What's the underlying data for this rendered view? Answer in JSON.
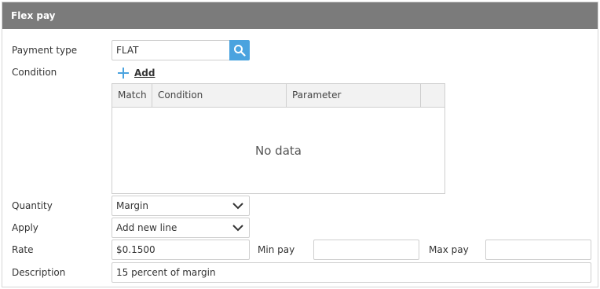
{
  "panel": {
    "title": "Flex pay"
  },
  "payment_type": {
    "label": "Payment type",
    "value": "FLAT"
  },
  "condition": {
    "label": "Condition",
    "add_label": "Add",
    "columns": [
      "Match",
      "Condition",
      "Parameter"
    ],
    "empty_text": "No data"
  },
  "quantity": {
    "label": "Quantity",
    "value": "Margin"
  },
  "apply": {
    "label": "Apply",
    "value": "Add new line"
  },
  "rate": {
    "label": "Rate",
    "value": "$0.1500"
  },
  "min_pay": {
    "label": "Min pay",
    "value": ""
  },
  "max_pay": {
    "label": "Max pay",
    "value": ""
  },
  "description": {
    "label": "Description",
    "value": "15 percent of margin"
  },
  "colors": {
    "header_bg": "#7b7b7b",
    "accent": "#4aa3df"
  }
}
